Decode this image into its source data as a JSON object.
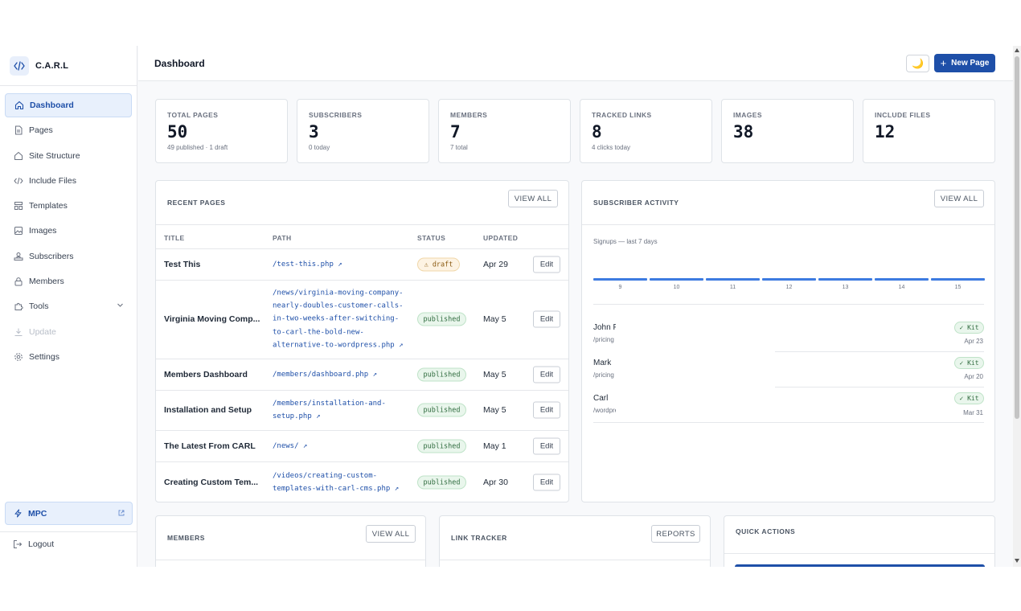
{
  "brand": {
    "name": "C.A.R.L"
  },
  "sidebar": {
    "items": [
      {
        "label": "Dashboard",
        "icon": "home-icon",
        "active": true
      },
      {
        "label": "Pages",
        "icon": "file-icon"
      },
      {
        "label": "Site Structure",
        "icon": "home-icon"
      },
      {
        "label": "Include Files",
        "icon": "code-icon"
      },
      {
        "label": "Templates",
        "icon": "template-icon"
      },
      {
        "label": "Images",
        "icon": "image-icon"
      },
      {
        "label": "Subscribers",
        "icon": "subscribers-icon"
      },
      {
        "label": "Members",
        "icon": "lock-icon"
      },
      {
        "label": "Tools",
        "icon": "puzzle-icon"
      },
      {
        "label": "Update",
        "icon": "download-icon",
        "disabled": true
      },
      {
        "label": "Settings",
        "icon": "gear-icon"
      }
    ],
    "mpc_label": "MPC",
    "logout_label": "Logout"
  },
  "header": {
    "title": "Dashboard",
    "theme_icon": "🌙",
    "new_page_label": "New Page"
  },
  "stats": [
    {
      "label": "TOTAL PAGES",
      "value": "50",
      "sub": "49 published · 1 draft"
    },
    {
      "label": "SUBSCRIBERS",
      "value": "3",
      "sub": "0 today"
    },
    {
      "label": "MEMBERS",
      "value": "7",
      "sub": "7 total"
    },
    {
      "label": "TRACKED LINKS",
      "value": "8",
      "sub": "4 clicks today"
    },
    {
      "label": "IMAGES",
      "value": "38",
      "sub": ""
    },
    {
      "label": "INCLUDE FILES",
      "value": "12",
      "sub": ""
    }
  ],
  "recent_pages": {
    "title": "RECENT PAGES",
    "view_all": "VIEW ALL",
    "columns": {
      "title": "TITLE",
      "path": "PATH",
      "status": "STATUS",
      "updated": "UPDATED"
    },
    "edit_label": "Edit",
    "rows": [
      {
        "title": "Test This",
        "path": "/test-this.php ↗",
        "status": "draft",
        "status_text": "⚠ draft",
        "updated": "Apr 29"
      },
      {
        "title": "Virginia Moving Comp...",
        "path": "/news/virginia-moving-company-nearly-doubles-customer-calls-in-two-weeks-after-switching-to-carl-the-bold-new-alternative-to-wordpress.php ↗",
        "status": "published",
        "status_text": "published",
        "updated": "May 5"
      },
      {
        "title": "Members Dashboard",
        "path": "/members/dashboard.php ↗",
        "status": "published",
        "status_text": "published",
        "updated": "May 5"
      },
      {
        "title": "Installation and Setup",
        "path": "/members/installation-and-setup.php ↗",
        "status": "published",
        "status_text": "published",
        "updated": "May 5"
      },
      {
        "title": "The Latest From CARL",
        "path": "/news/ ↗",
        "status": "published",
        "status_text": "published",
        "updated": "May 1"
      },
      {
        "title": "Creating Custom Tem...",
        "path": "/videos/creating-custom-templates-with-carl-cms.php ↗",
        "status": "published",
        "status_text": "published",
        "updated": "Apr 30"
      }
    ]
  },
  "subscriber_activity": {
    "title": "SUBSCRIBER ACTIVITY",
    "view_all": "VIEW ALL",
    "chart_label": "Signups — last 7 days",
    "days": [
      "9",
      "10",
      "11",
      "12",
      "13",
      "14",
      "15"
    ],
    "signups": [
      0,
      0,
      0,
      0,
      0,
      0,
      0
    ],
    "bar_color": "#3d7be0",
    "entries": [
      {
        "name": "John F",
        "path": "/pricing",
        "badge": "✓ Kit",
        "date": "Apr 23"
      },
      {
        "name": "Mark",
        "path": "/pricing",
        "badge": "✓ Kit",
        "date": "Apr 20"
      },
      {
        "name": "Carl",
        "path": "/wordpress",
        "badge": "✓ Kit",
        "date": "Mar 31"
      }
    ]
  },
  "members_panel": {
    "title": "MEMBERS",
    "view_all": "VIEW ALL"
  },
  "link_tracker": {
    "title": "LINK TRACKER",
    "reports": "REPORTS"
  },
  "quick_actions": {
    "title": "QUICK ACTIONS"
  },
  "colors": {
    "accent": "#1e4fa8",
    "published_bg": "#e9f6ec",
    "draft_bg": "#fdf3e3"
  }
}
